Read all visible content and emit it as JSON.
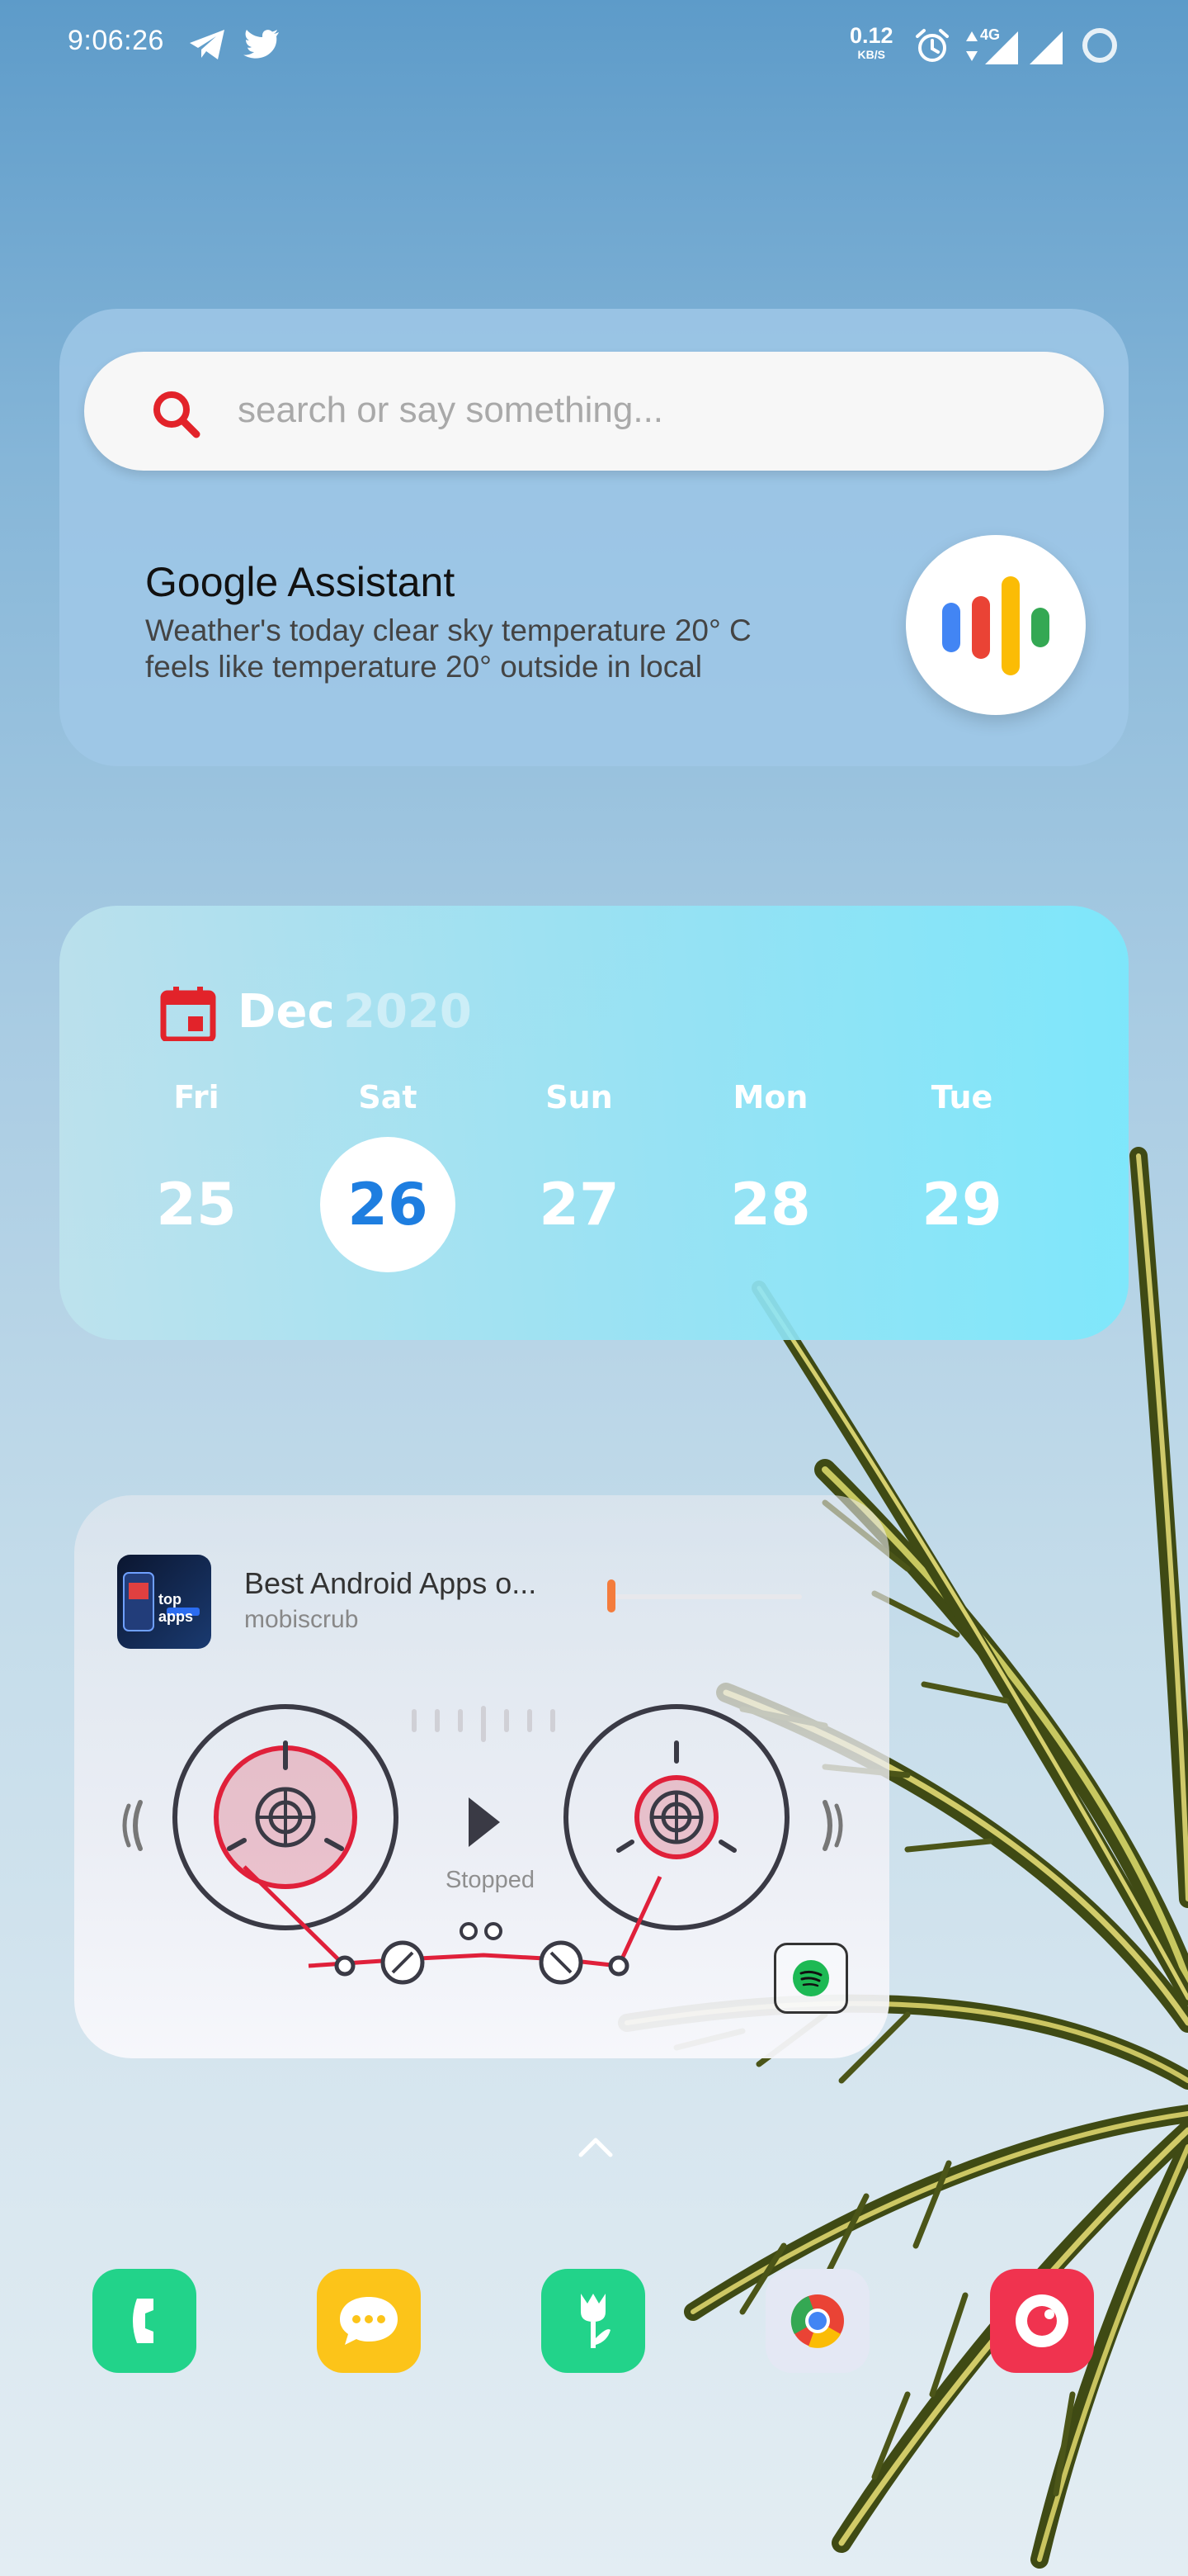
{
  "status_bar": {
    "time": "9:06:26",
    "net_speed_value": "0.12",
    "net_speed_unit": "KB/S",
    "network_label": "4G",
    "icons": [
      "telegram-icon",
      "twitter-icon",
      "alarm-icon",
      "data-arrows-icon",
      "signal-icon",
      "signal-icon",
      "loading-ring-icon"
    ]
  },
  "search_widget": {
    "placeholder": "search or say something...",
    "assistant_title": "Google Assistant",
    "assistant_line1": "Weather's today clear sky temperature 20°  C",
    "assistant_line2": "feels like temperature 20° outside in local",
    "icons": [
      "search-icon",
      "google-assistant-mic-icon"
    ]
  },
  "calendar_widget": {
    "month": "Dec",
    "year": "2020",
    "days": [
      {
        "name": "Fri",
        "num": "25",
        "selected": false
      },
      {
        "name": "Sat",
        "num": "26",
        "selected": true
      },
      {
        "name": "Sun",
        "num": "27",
        "selected": false
      },
      {
        "name": "Mon",
        "num": "28",
        "selected": false
      },
      {
        "name": "Tue",
        "num": "29",
        "selected": false
      }
    ],
    "accent_color": "#e2232a",
    "selected_color": "#1e7ee0"
  },
  "music_widget": {
    "track_title": "Best Android Apps o...",
    "artist": "mobiscrub",
    "album_art_text": "top apps",
    "status": "Stopped",
    "progress": 0.0,
    "accent_color": "#e0203a",
    "seek_color": "#f47c3c",
    "icons": [
      "play-icon",
      "spotify-icon"
    ]
  },
  "dock": {
    "apps": [
      {
        "name": "phone-app",
        "color": "#22d38a"
      },
      {
        "name": "messages-app",
        "color": "#fcc419"
      },
      {
        "name": "flower-app",
        "color": "#22d38a"
      },
      {
        "name": "chrome-app",
        "color": "#e4e8f4"
      },
      {
        "name": "camera-app",
        "color": "#f0334f"
      }
    ]
  }
}
